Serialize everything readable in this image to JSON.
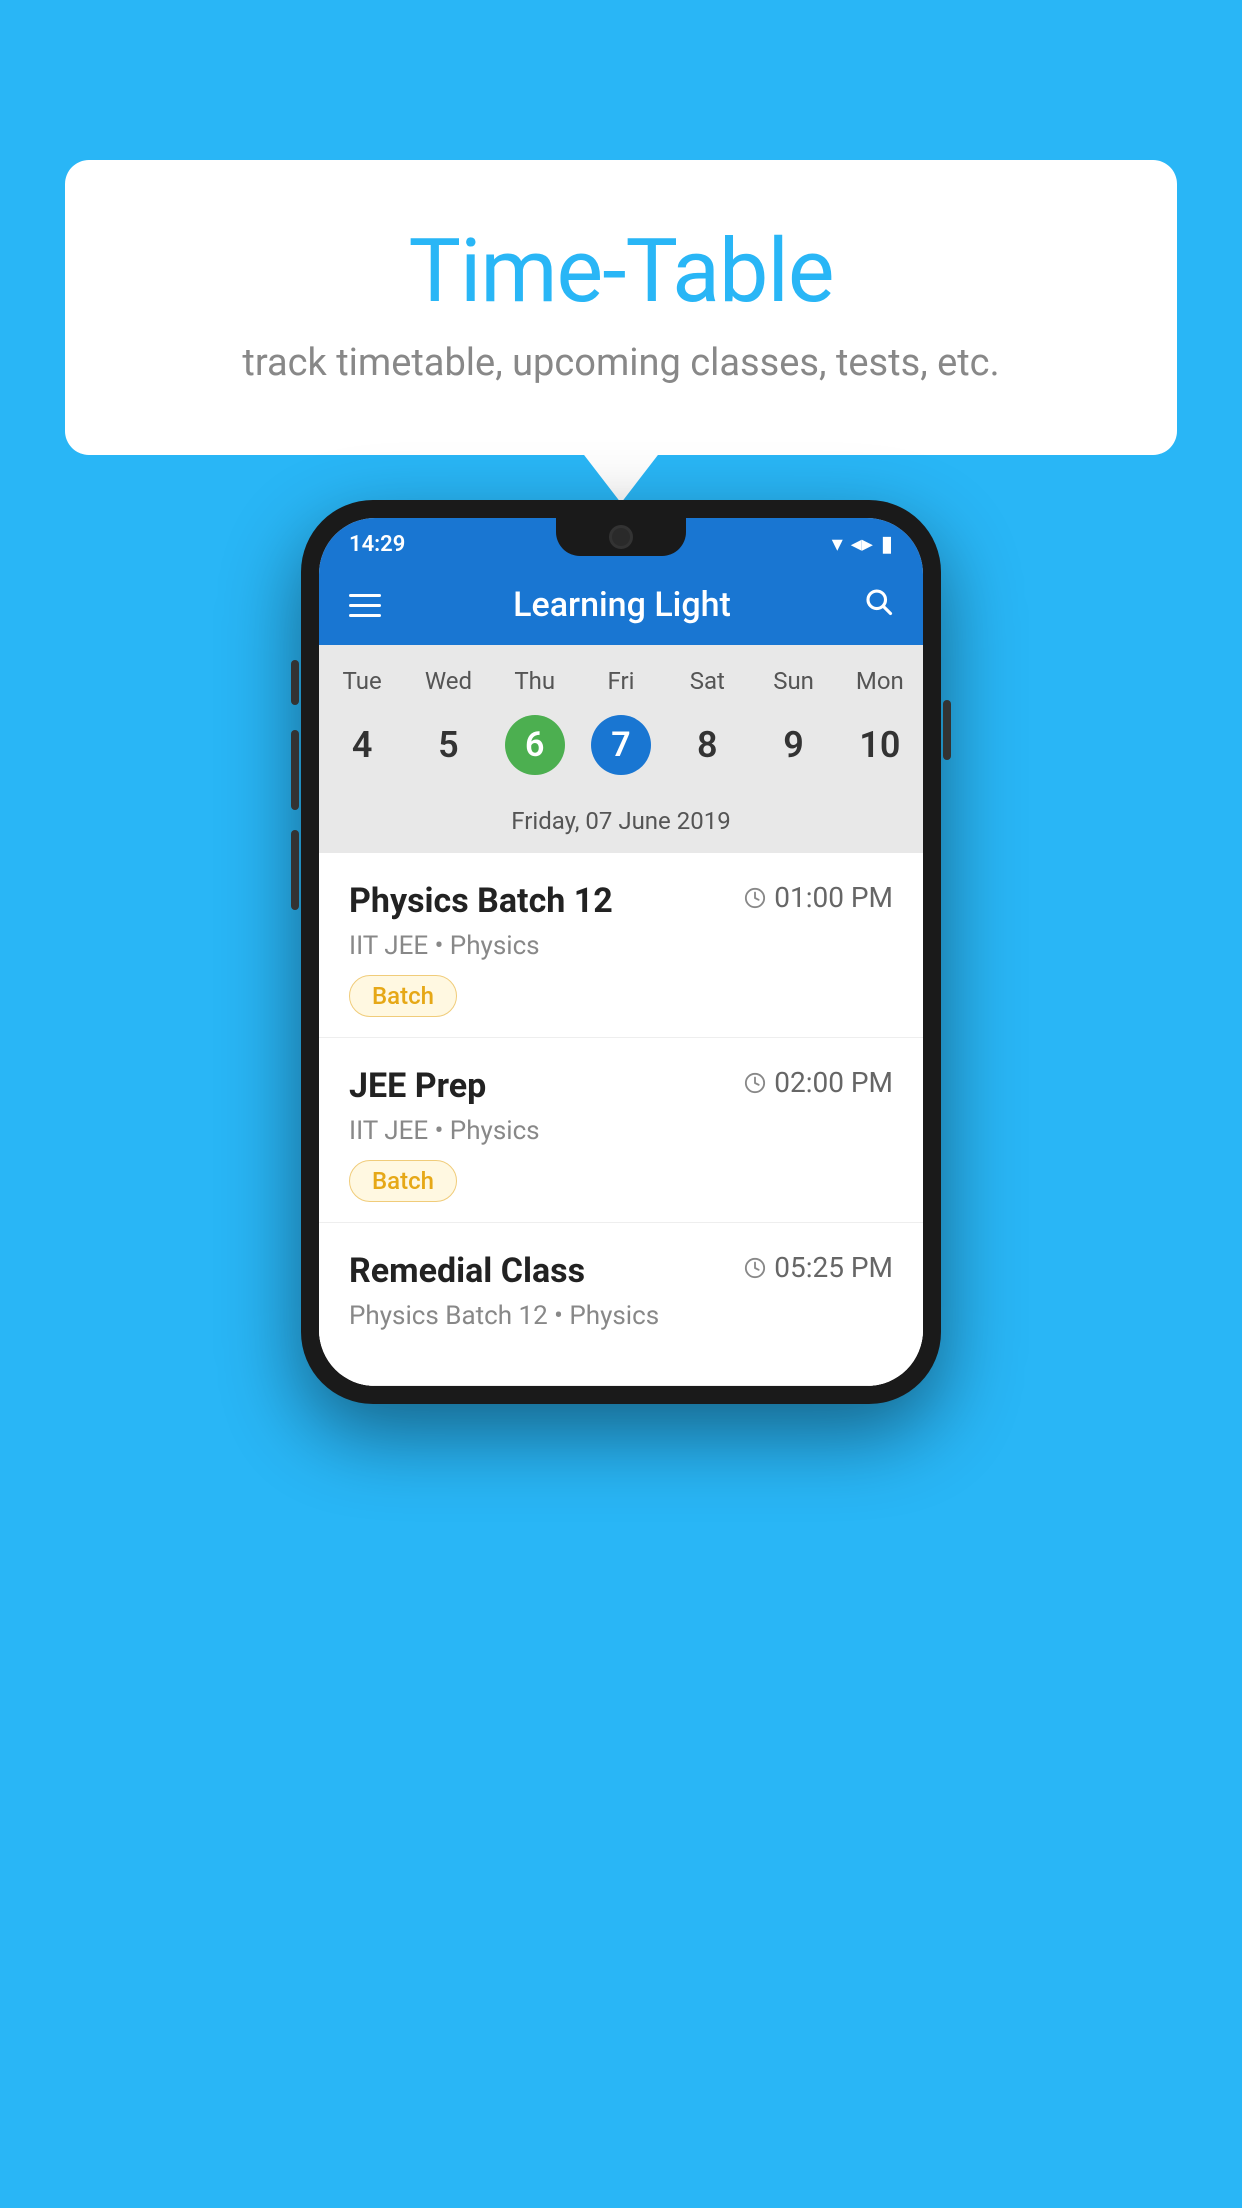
{
  "background_color": "#29b6f6",
  "tooltip": {
    "title": "Time-Table",
    "subtitle": "track timetable, upcoming classes, tests, etc."
  },
  "phone": {
    "status_bar": {
      "time": "14:29",
      "icons": [
        "wifi",
        "signal",
        "battery"
      ]
    },
    "app_bar": {
      "title": "Learning Light",
      "menu_icon_label": "hamburger-icon",
      "search_icon_label": "search-icon"
    },
    "calendar": {
      "days": [
        "Tue",
        "Wed",
        "Thu",
        "Fri",
        "Sat",
        "Sun",
        "Mon"
      ],
      "dates": [
        "4",
        "5",
        "6",
        "7",
        "8",
        "9",
        "10"
      ],
      "today_index": 2,
      "selected_index": 3,
      "selected_date_label": "Friday, 07 June 2019"
    },
    "schedule_items": [
      {
        "title": "Physics Batch 12",
        "time": "01:00 PM",
        "sub": "IIT JEE • Physics",
        "badge": "Batch"
      },
      {
        "title": "JEE Prep",
        "time": "02:00 PM",
        "sub": "IIT JEE • Physics",
        "badge": "Batch"
      },
      {
        "title": "Remedial Class",
        "time": "05:25 PM",
        "sub": "Physics Batch 12 • Physics",
        "badge": null
      }
    ]
  }
}
